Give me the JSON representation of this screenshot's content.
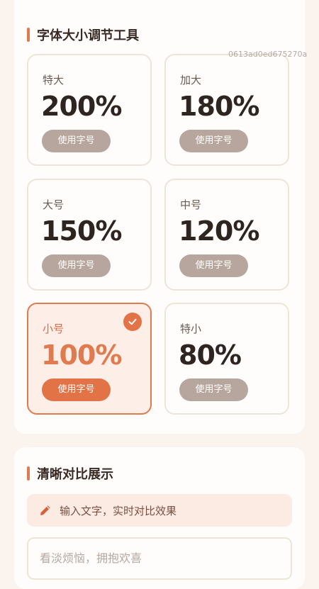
{
  "font_tool": {
    "title": "字体大小调节工具",
    "tag": "0613ad0ed675270a",
    "options": [
      {
        "label": "特大",
        "percent": "200%",
        "button": "使用字号",
        "selected": false
      },
      {
        "label": "加大",
        "percent": "180%",
        "button": "使用字号",
        "selected": false
      },
      {
        "label": "大号",
        "percent": "150%",
        "button": "使用字号",
        "selected": false
      },
      {
        "label": "中号",
        "percent": "120%",
        "button": "使用字号",
        "selected": false
      },
      {
        "label": "小号",
        "percent": "100%",
        "button": "使用字号",
        "selected": true
      },
      {
        "label": "特小",
        "percent": "80%",
        "button": "使用字号",
        "selected": false
      }
    ]
  },
  "compare": {
    "title": "清晰对比展示",
    "hint": "输入文字，实时对比效果",
    "input_placeholder": "看淡烦恼，拥抱欢喜"
  },
  "icons": {
    "section_marker": "accent-bar",
    "check": "check-icon",
    "pencil": "pencil-icon"
  },
  "colors": {
    "accent": "#e07a4f",
    "button_gray": "#b7a69e",
    "selected_bg": "#fdeee7"
  }
}
